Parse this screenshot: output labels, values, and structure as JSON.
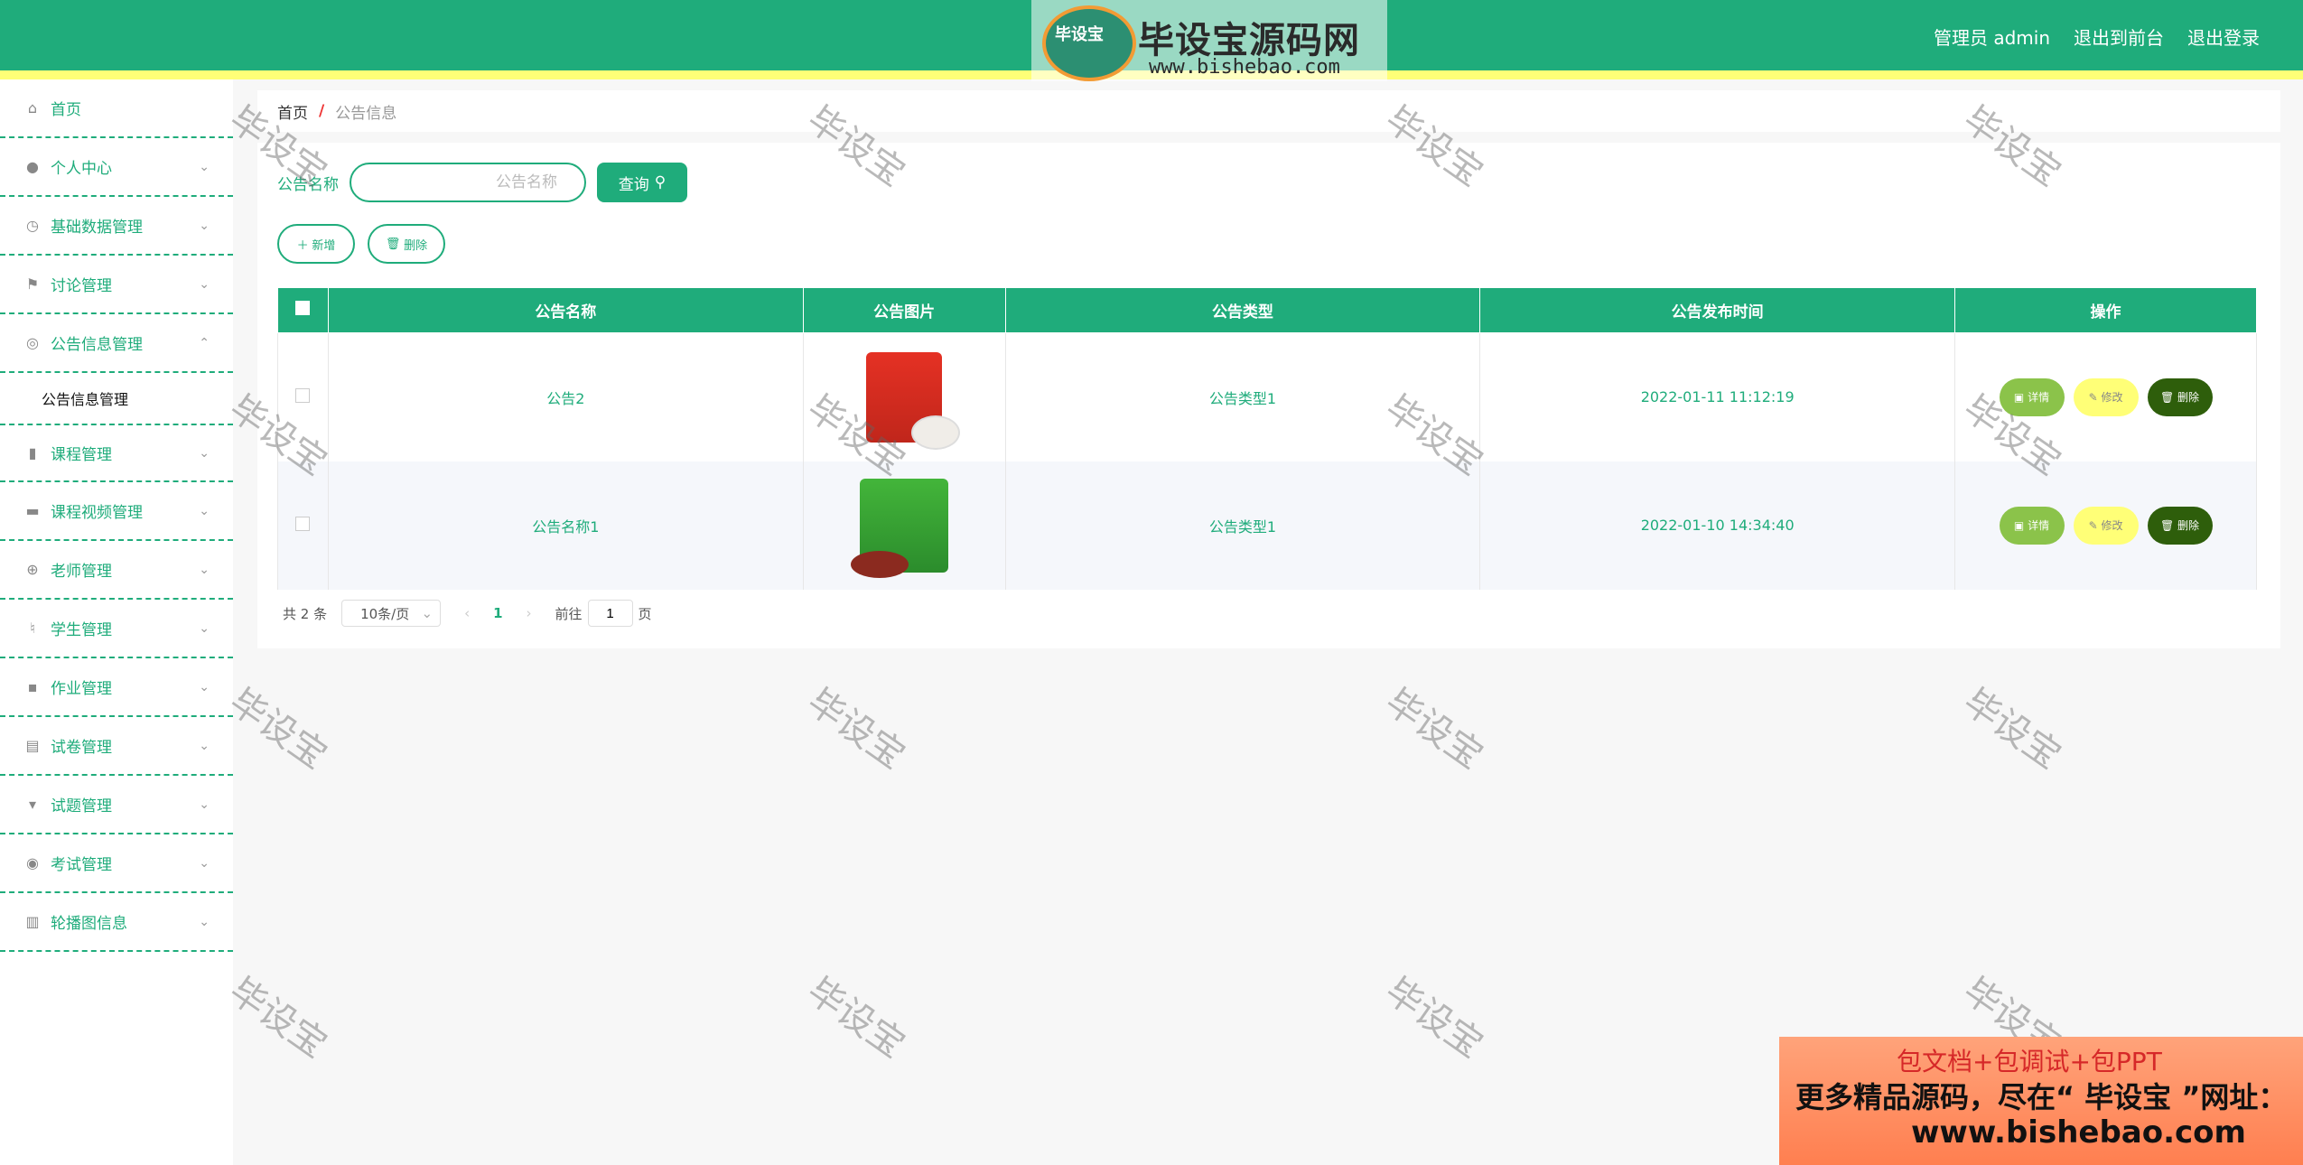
{
  "header": {
    "user": "管理员 admin",
    "front": "退出到前台",
    "logout": "退出登录",
    "logo_badge": "毕设宝",
    "logo_title": "毕设宝源码网",
    "logo_url": "www.bishebao.com"
  },
  "sidebar": {
    "items": [
      {
        "label": "首页",
        "icon": "home-icon"
      },
      {
        "label": "个人中心",
        "icon": "user-icon"
      },
      {
        "label": "基础数据管理",
        "icon": "clock-icon"
      },
      {
        "label": "讨论管理",
        "icon": "flag-icon"
      },
      {
        "label": "公告信息管理",
        "icon": "compass-icon"
      },
      {
        "label": "课程管理",
        "icon": "pin-icon"
      },
      {
        "label": "课程视频管理",
        "icon": "briefcase-icon"
      },
      {
        "label": "老师管理",
        "icon": "globe-icon"
      },
      {
        "label": "学生管理",
        "icon": "mic-icon"
      },
      {
        "label": "作业管理",
        "icon": "chat-icon"
      },
      {
        "label": "试卷管理",
        "icon": "clipboard-icon"
      },
      {
        "label": "试题管理",
        "icon": "pushpin-icon"
      },
      {
        "label": "考试管理",
        "icon": "circle-icon"
      },
      {
        "label": "轮播图信息",
        "icon": "bar-chart-icon"
      }
    ],
    "sub": "公告信息管理"
  },
  "breadcrumb": {
    "home": "首页",
    "sep": "/",
    "current": "公告信息"
  },
  "search": {
    "label": "公告名称",
    "placeholder": "公告名称",
    "button": "查询"
  },
  "actions": {
    "add": "新增",
    "delete": "删除"
  },
  "table": {
    "headers": [
      "公告名称",
      "公告图片",
      "公告类型",
      "公告发布时间",
      "操作"
    ],
    "rows": [
      {
        "name": "公告2",
        "type": "公告类型1",
        "time": "2022-01-11 11:12:19"
      },
      {
        "name": "公告名称1",
        "type": "公告类型1",
        "time": "2022-01-10 14:34:40"
      }
    ],
    "ops": {
      "detail": "详情",
      "edit": "修改",
      "delete": "删除"
    }
  },
  "pager": {
    "total": "共 2 条",
    "size": "10条/页",
    "current": "1",
    "goto": "前往",
    "goto_value": "1",
    "unit": "页"
  },
  "watermark": "毕设宝",
  "promo": {
    "l1": "包文档+包调试+包PPT",
    "l2": "更多精品源码，尽在“ 毕设宝 ”网址：",
    "l3": "www.bishebao.com"
  },
  "colors": {
    "primary": "#1fac7b",
    "accent_yellow": "#ffff77",
    "detail": "#8bc34a",
    "delete": "#2e5e0b"
  }
}
